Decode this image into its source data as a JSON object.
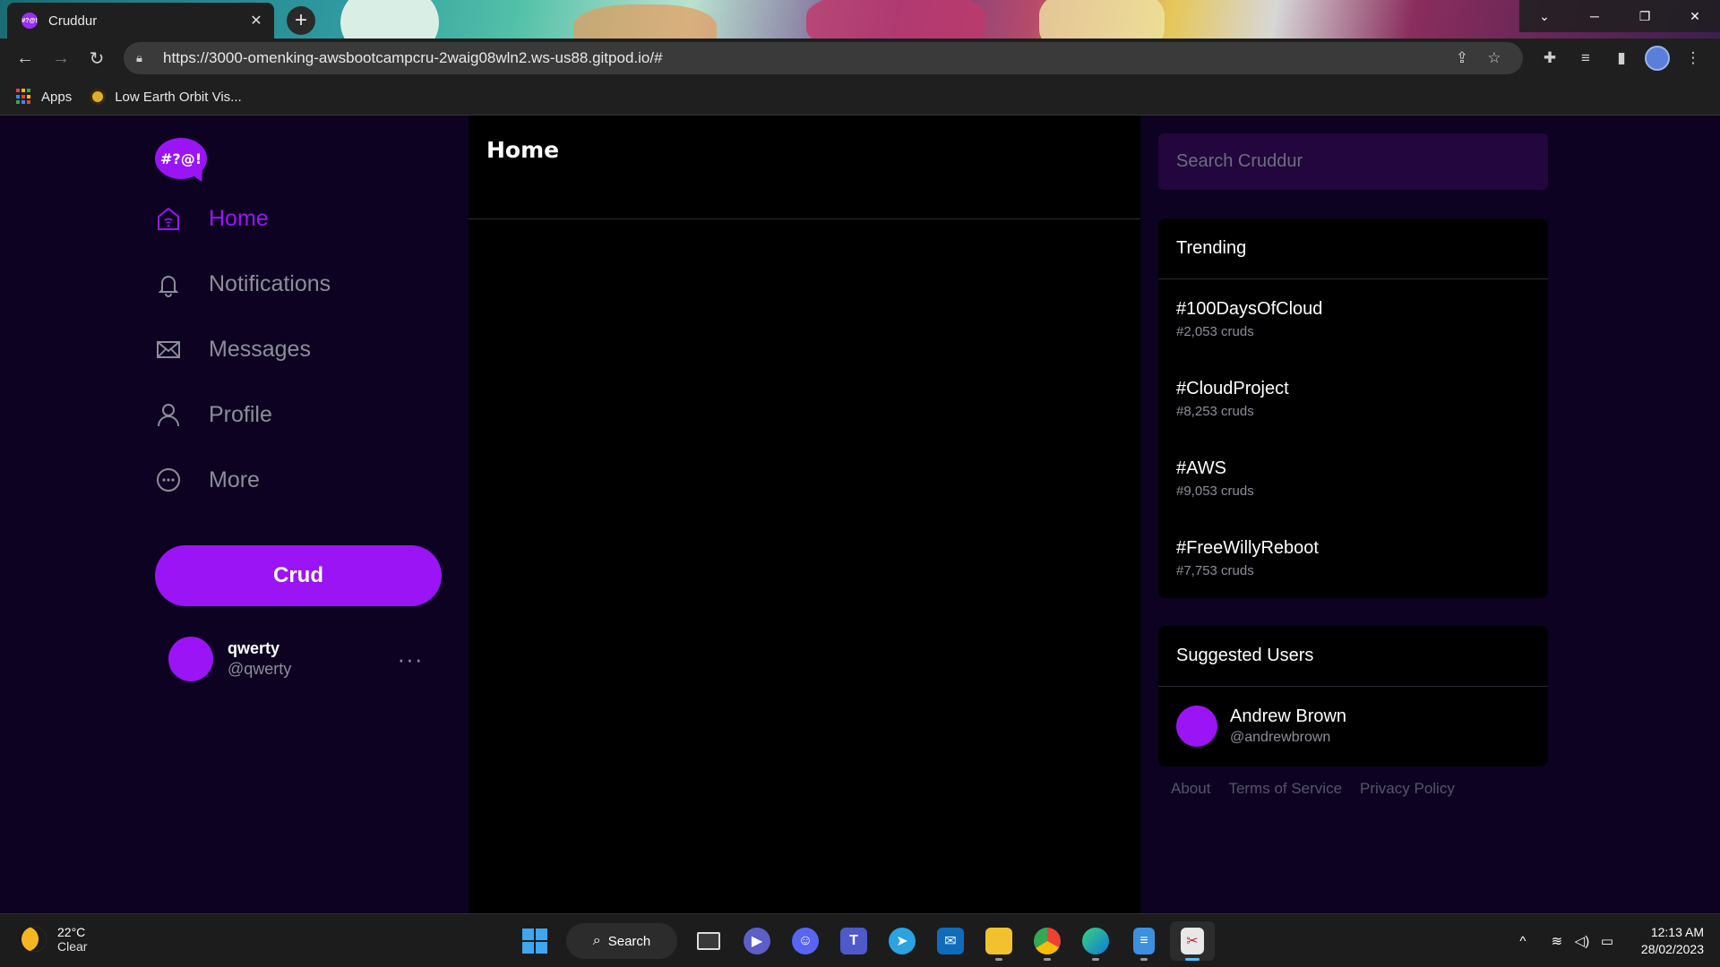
{
  "browser": {
    "tab_title": "Cruddur",
    "url": "https://3000-omenking-awsbootcampcru-2waig08wln2.ws-us88.gitpod.io/#",
    "bookmarks": [
      {
        "label": "Apps",
        "icon": "apps-grid-icon"
      },
      {
        "label": "Low Earth Orbit Vis...",
        "icon": "leo-icon"
      }
    ]
  },
  "app": {
    "logo_text": "#?@!",
    "accent_color": "#9b14f5",
    "nav": [
      {
        "label": "Home",
        "icon": "home-icon",
        "active": true
      },
      {
        "label": "Notifications",
        "icon": "bell-icon",
        "active": false
      },
      {
        "label": "Messages",
        "icon": "envelope-icon",
        "active": false
      },
      {
        "label": "Profile",
        "icon": "person-icon",
        "active": false
      },
      {
        "label": "More",
        "icon": "more-circle-icon",
        "active": false
      }
    ],
    "crud_button": "Crud",
    "current_user": {
      "display_name": "qwerty",
      "handle": "@qwerty",
      "menu": "..."
    },
    "feed": {
      "title": "Home"
    },
    "search": {
      "placeholder": "Search Cruddur"
    },
    "trending": {
      "title": "Trending",
      "items": [
        {
          "tag": "#100DaysOfCloud",
          "count": "#2,053 cruds"
        },
        {
          "tag": "#CloudProject",
          "count": "#8,253 cruds"
        },
        {
          "tag": "#AWS",
          "count": "#9,053 cruds"
        },
        {
          "tag": "#FreeWillyReboot",
          "count": "#7,753 cruds"
        }
      ]
    },
    "suggested": {
      "title": "Suggested Users",
      "users": [
        {
          "display_name": "Andrew Brown",
          "handle": "@andrewbrown"
        }
      ]
    },
    "footer_links": [
      "About",
      "Terms of Service",
      "Privacy Policy"
    ]
  },
  "taskbar": {
    "weather": {
      "temp": "22°C",
      "condition": "Clear"
    },
    "search_label": "Search",
    "time": "12:13 AM",
    "date": "28/02/2023"
  }
}
